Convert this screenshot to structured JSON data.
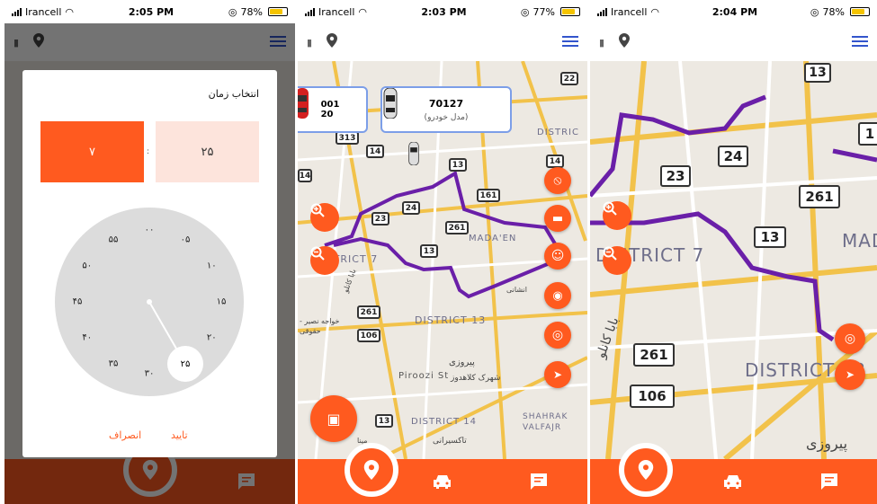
{
  "status_bars": [
    {
      "carrier": "Irancell",
      "time": "2:05 PM",
      "battery": "78%",
      "battery_level": 0.78
    },
    {
      "carrier": "Irancell",
      "time": "2:03 PM",
      "battery": "77%",
      "battery_level": 0.77
    },
    {
      "carrier": "Irancell",
      "time": "2:04 PM",
      "battery": "78%",
      "battery_level": 0.78
    }
  ],
  "time_picker": {
    "title": "انتخاب زمان",
    "hour": "۷",
    "minute": "۲۵",
    "separator": ":",
    "clock_numbers": [
      "۰۰",
      "۰۵",
      "۱۰",
      "۱۵",
      "۲۰",
      "۲۵",
      "۳۰",
      "۳۵",
      "۴۰",
      "۴۵",
      "۵۰",
      "۵۵"
    ],
    "selected_minute": "۲۵",
    "confirm_label": "تایید",
    "cancel_label": "انصراف"
  },
  "car_cards": [
    {
      "plate": "001",
      "line2": "20"
    },
    {
      "plate": "70127",
      "line2": "(مدل خودرو)"
    }
  ],
  "map2": {
    "road_badges": [
      "313",
      "14",
      "13",
      "161",
      "23",
      "24",
      "261",
      "13",
      "261",
      "106",
      "14",
      "22",
      "13",
      "14"
    ],
    "labels": [
      "DISTRICT 7",
      "MADA'EN",
      "DISTRICT 13",
      "Piroozi St",
      "DISTRICT 14",
      "SHAHRAK VALFAJR",
      "DISTRIC",
      "پیروزی",
      "شهرک کلاهدوز",
      "تاکسیرانی",
      "خواجه نصیر - حقوقی",
      "بابا کانلو",
      "انشانی",
      "مینا"
    ]
  },
  "map3": {
    "road_badges": [
      "13",
      "24",
      "23",
      "261",
      "13",
      "261",
      "106",
      "1"
    ],
    "labels": [
      "DISTRICT 7",
      "MAD",
      "DISTRICT 13",
      "پیروزی",
      "بابا کانلو"
    ]
  },
  "colors": {
    "accent": "#ff5a1f",
    "route": "#6a1fa8",
    "card_border": "#7c9ee8"
  }
}
